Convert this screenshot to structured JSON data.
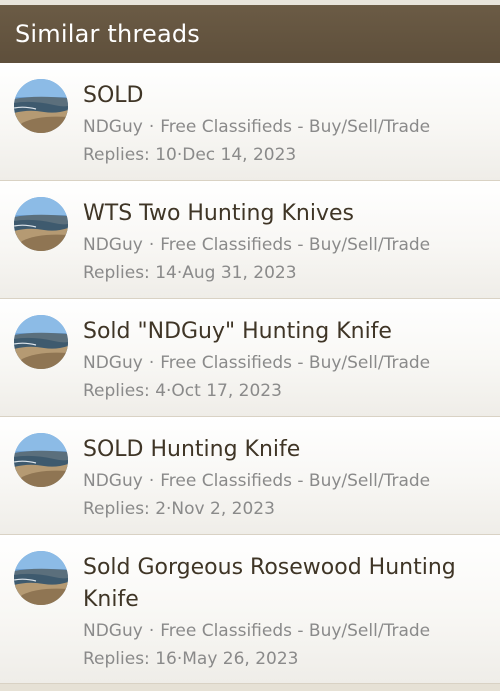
{
  "header": {
    "title": "Similar threads"
  },
  "threads": [
    {
      "title": "SOLD",
      "author": "NDGuy",
      "forum": "Free Classifieds - Buy/Sell/Trade",
      "replies_label": "Replies: 10",
      "date": "Dec 14, 2023"
    },
    {
      "title": "WTS Two Hunting Knives",
      "author": "NDGuy",
      "forum": "Free Classifieds - Buy/Sell/Trade",
      "replies_label": "Replies: 14",
      "date": "Aug 31, 2023"
    },
    {
      "title": "Sold \"NDGuy\" Hunting Knife",
      "author": "NDGuy",
      "forum": "Free Classifieds - Buy/Sell/Trade",
      "replies_label": "Replies: 4",
      "date": "Oct 17, 2023"
    },
    {
      "title": "SOLD Hunting Knife",
      "author": "NDGuy",
      "forum": "Free Classifieds - Buy/Sell/Trade",
      "replies_label": "Replies: 2",
      "date": "Nov 2, 2023"
    },
    {
      "title": "Sold Gorgeous Rosewood Hunting Knife",
      "author": "NDGuy",
      "forum": "Free Classifieds - Buy/Sell/Trade",
      "replies_label": "Replies: 16",
      "date": "May 26, 2023"
    }
  ],
  "separator": "·",
  "colors": {
    "header_bg": "#5e4f3b",
    "title_text": "#3f3526",
    "meta_text": "#8a8a8a"
  }
}
